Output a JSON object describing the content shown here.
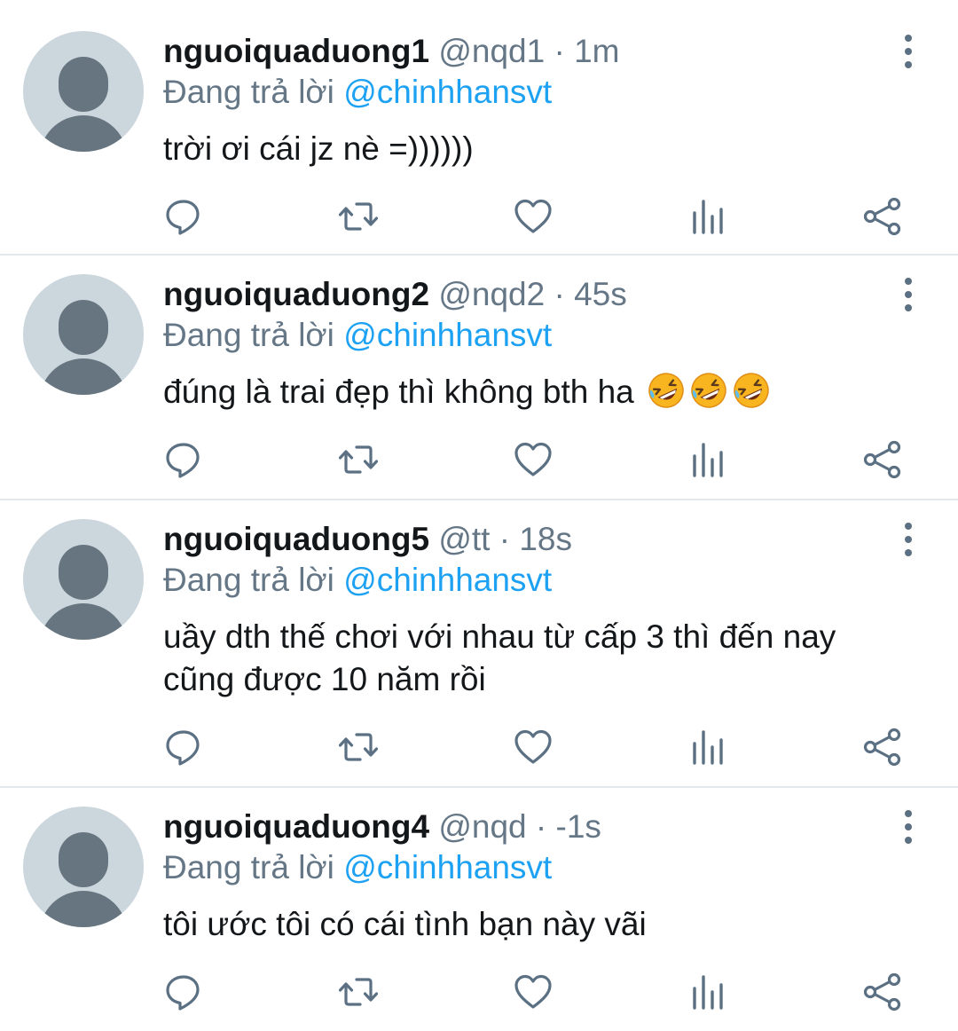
{
  "tweets": [
    {
      "display_name": "nguoiquaduong1",
      "handle": "@nqd1",
      "time": "1m",
      "reply_prefix": "Đang trả lời",
      "reply_to": "@chinhhansvt",
      "text": "trời ơi cái jz nè =))))))"
    },
    {
      "display_name": "nguoiquaduong2",
      "handle": "@nqd2",
      "time": "45s",
      "reply_prefix": "Đang trả lời",
      "reply_to": "@chinhhansvt",
      "text": "đúng là trai đẹp thì không bth ha",
      "emojis": [
        "rofl-emoji",
        "rofl-emoji",
        "rofl-emoji"
      ]
    },
    {
      "display_name": "nguoiquaduong5",
      "handle": "@tt",
      "time": "18s",
      "reply_prefix": "Đang trả lời",
      "reply_to": "@chinhhansvt",
      "text_line1": "uầy dth thế chơi với nhau từ cấp 3 thì đến nay",
      "text_line2": "cũng được 10 năm rồi"
    },
    {
      "display_name": "nguoiquaduong4",
      "handle": "@nqd",
      "time": "-1s",
      "reply_prefix": "Đang trả lời",
      "reply_to": "@chinhhansvt",
      "text": "tôi ước tôi có cái tình bạn này vãi"
    }
  ],
  "separator": "·",
  "icons": [
    "avatar-placeholder-icon",
    "more-vertical-icon",
    "reply-icon",
    "retweet-icon",
    "like-heart-icon",
    "analytics-icon",
    "share-icon"
  ],
  "colors": {
    "link": "#1da1f2",
    "secondary_text": "#657786",
    "primary_text": "#14171a",
    "avatar_bg": "#ccd6dd",
    "avatar_fg": "#66757f",
    "divider": "#e3e8ec"
  }
}
